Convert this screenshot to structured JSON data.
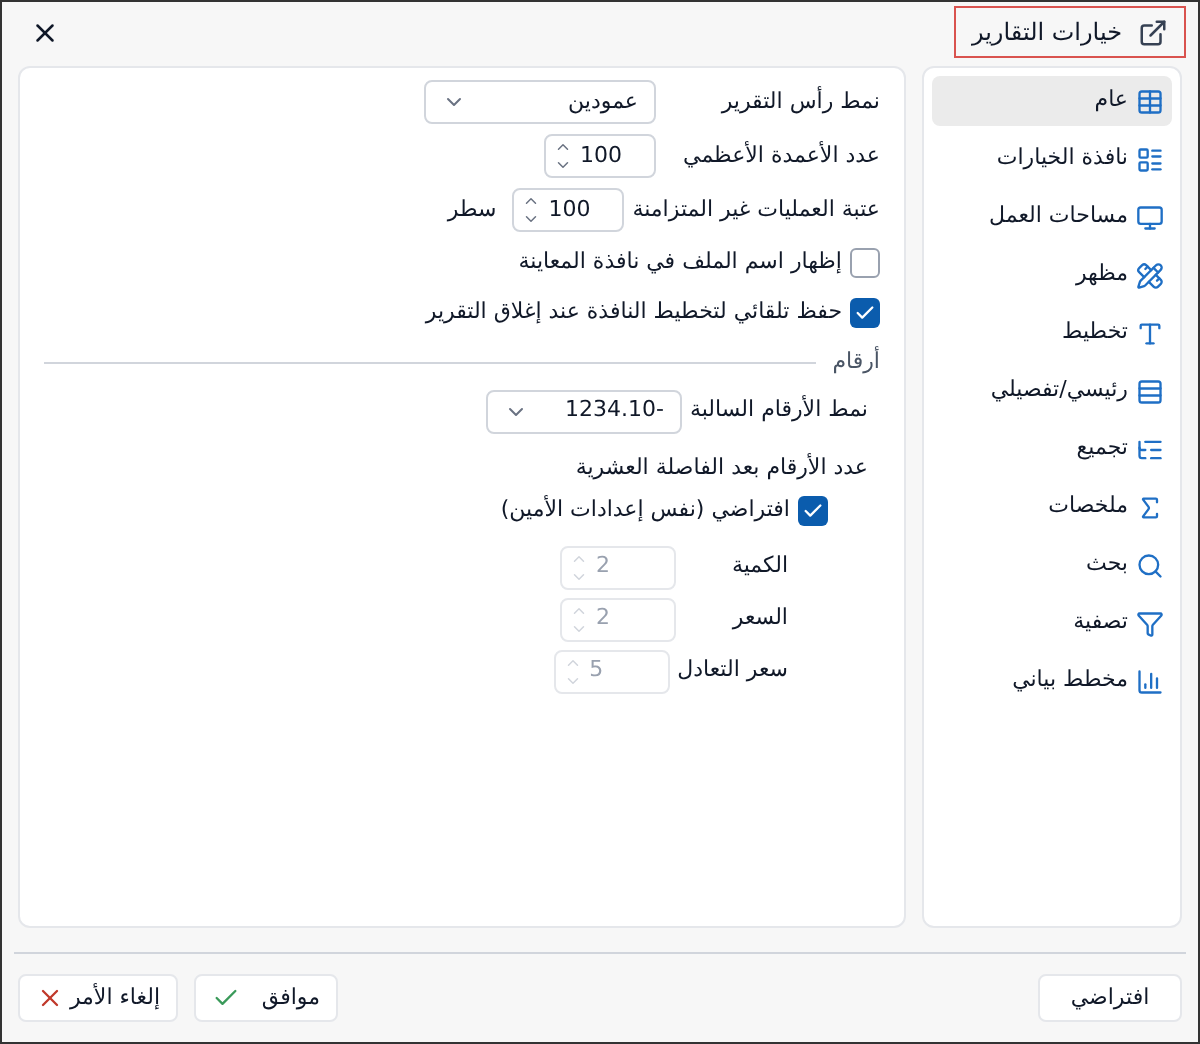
{
  "window": {
    "title": "خيارات التقارير"
  },
  "sidebar": {
    "items": [
      {
        "label": "عام",
        "selected": true
      },
      {
        "label": "نافذة الخيارات",
        "selected": false
      },
      {
        "label": "مساحات العمل",
        "selected": false
      },
      {
        "label": "مظهر",
        "selected": false
      },
      {
        "label": "تخطيط",
        "selected": false
      },
      {
        "label": "رئيسي/تفصيلي",
        "selected": false
      },
      {
        "label": "تجميع",
        "selected": false
      },
      {
        "label": "ملخصات",
        "selected": false
      },
      {
        "label": "بحث",
        "selected": false
      },
      {
        "label": "تصفية",
        "selected": false
      },
      {
        "label": "مخطط بياني",
        "selected": false
      }
    ]
  },
  "general": {
    "rows": [
      {
        "kind": "select",
        "label": "نمط رأس التقرير",
        "value": "عمودين"
      },
      {
        "kind": "spinner",
        "label": "عدد الأعمدة الأعظمي",
        "value": "100"
      },
      {
        "kind": "spinner",
        "label": "عتبة العمليات غير المتزامنة",
        "value": "100",
        "unit": "سطر"
      },
      {
        "kind": "checkbox",
        "label": "إظهار اسم الملف في نافذة المعاينة",
        "checked": false
      },
      {
        "kind": "checkbox",
        "label": "حفظ تلقائي لتخطيط النافذة عند إغلاق التقرير",
        "checked": true
      }
    ]
  },
  "numbers": {
    "title": "أرقام",
    "negative": {
      "label": "نمط الأرقام السالبة",
      "value": "-1234.10"
    },
    "decimals_label": "عدد الأرقام بعد الفاصلة العشرية",
    "default_option": {
      "label": "افتراضي (نفس إعدادات الأمين)",
      "checked": true
    },
    "decimals": [
      {
        "label": "الكمية",
        "value": "2",
        "disabled": true
      },
      {
        "label": "السعر",
        "value": "2",
        "disabled": true
      },
      {
        "label": "سعر التعادل",
        "value": "5",
        "disabled": true
      }
    ]
  },
  "buttons": {
    "defaults": "افتراضي",
    "ok": "موافق",
    "cancel": "إلغاء الأمر"
  }
}
